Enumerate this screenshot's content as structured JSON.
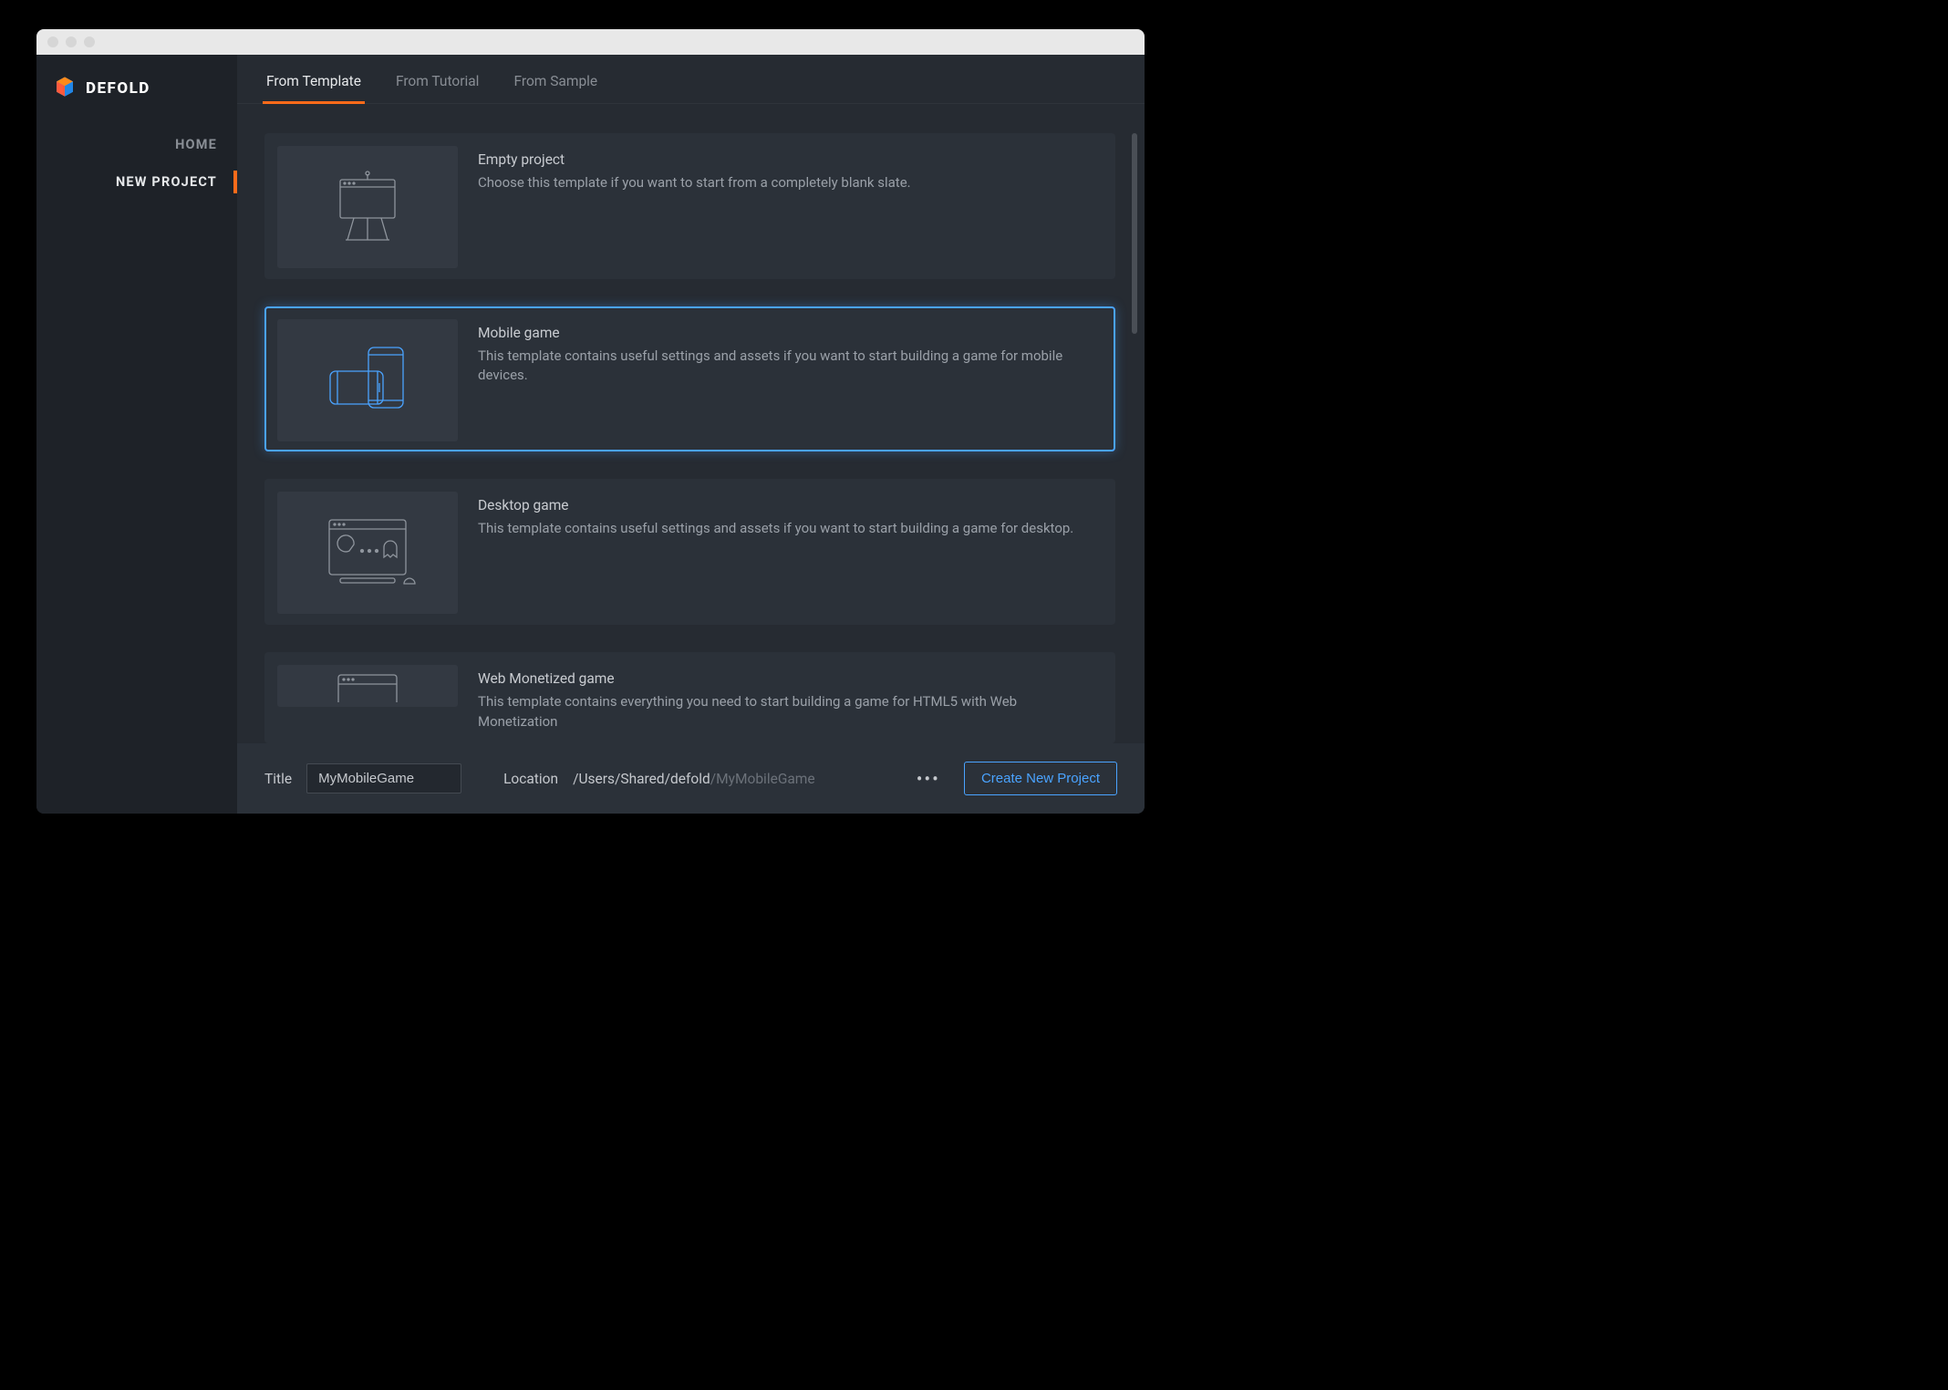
{
  "brand": "DEFOLD",
  "sidebar": {
    "items": [
      {
        "label": "HOME",
        "active": false
      },
      {
        "label": "NEW PROJECT",
        "active": true
      }
    ]
  },
  "tabs": [
    {
      "label": "From Template",
      "active": true
    },
    {
      "label": "From Tutorial",
      "active": false
    },
    {
      "label": "From Sample",
      "active": false
    }
  ],
  "templates": [
    {
      "title": "Empty project",
      "desc": "Choose this template if you want to start from a completely blank slate.",
      "selected": false,
      "icon": "easel-icon"
    },
    {
      "title": "Mobile game",
      "desc": "This template contains useful settings and assets if you want to start building a game for mobile devices.",
      "selected": true,
      "icon": "mobile-devices-icon"
    },
    {
      "title": "Desktop game",
      "desc": "This template contains useful settings and assets if you want to start building a game for desktop.",
      "selected": false,
      "icon": "desktop-pacman-icon"
    },
    {
      "title": "Web Monetized game",
      "desc": "This template contains everything you need to start building a game for HTML5 with Web Monetization",
      "selected": false,
      "icon": "browser-window-icon"
    }
  ],
  "footer": {
    "title_label": "Title",
    "title_value": "MyMobileGame",
    "location_label": "Location",
    "location_path": "/Users/Shared/defold",
    "location_suffix": "/MyMobileGame",
    "create_label": "Create New Project"
  },
  "colors": {
    "accent_orange": "#ff6b1a",
    "accent_blue": "#4aa3ff"
  }
}
